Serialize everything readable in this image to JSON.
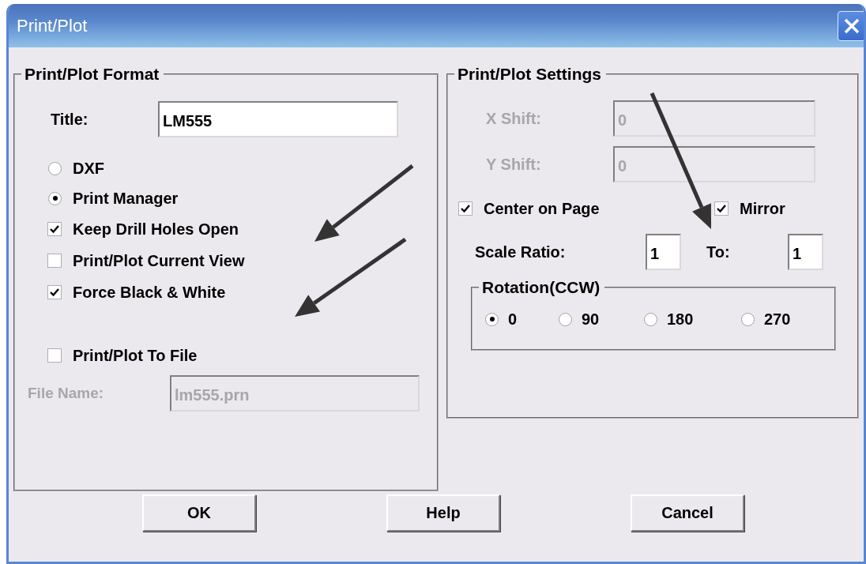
{
  "window": {
    "title": "Print/Plot"
  },
  "format": {
    "title": "Print/Plot Format",
    "title_field": {
      "label": "Title:",
      "value": "LM555"
    },
    "options": [
      {
        "kind": "radio",
        "label": "DXF",
        "selected": false
      },
      {
        "kind": "radio",
        "label": "Print Manager",
        "selected": true
      },
      {
        "kind": "checkbox",
        "label": "Keep Drill Holes Open",
        "checked": true
      },
      {
        "kind": "checkbox",
        "label": "Print/Plot Current View",
        "checked": false
      },
      {
        "kind": "checkbox",
        "label": "Force Black & White",
        "checked": true
      }
    ],
    "to_file": {
      "label": "Print/Plot To File",
      "checked": false
    },
    "file_name": {
      "label": "File Name:",
      "value": "lm555.prn",
      "disabled": true
    }
  },
  "settings": {
    "title": "Print/Plot Settings",
    "shifts": [
      {
        "label": "X Shift:",
        "value": "0",
        "disabled": true
      },
      {
        "label": "Y Shift:",
        "value": "0",
        "disabled": true
      }
    ],
    "center_on_page": {
      "label": "Center on Page",
      "checked": true
    },
    "mirror": {
      "label": "Mirror",
      "checked": true
    },
    "scale_ratio": {
      "label": "Scale Ratio:",
      "value": "1"
    },
    "scale_to": {
      "label": "To:",
      "value": "1"
    },
    "rotation": {
      "title": "Rotation(CCW)",
      "options": [
        {
          "label": "0",
          "selected": true
        },
        {
          "label": "90",
          "selected": false
        },
        {
          "label": "180",
          "selected": false
        },
        {
          "label": "270",
          "selected": false
        }
      ]
    }
  },
  "buttons": [
    {
      "label": "OK"
    },
    {
      "label": "Help"
    },
    {
      "label": "Cancel"
    }
  ]
}
